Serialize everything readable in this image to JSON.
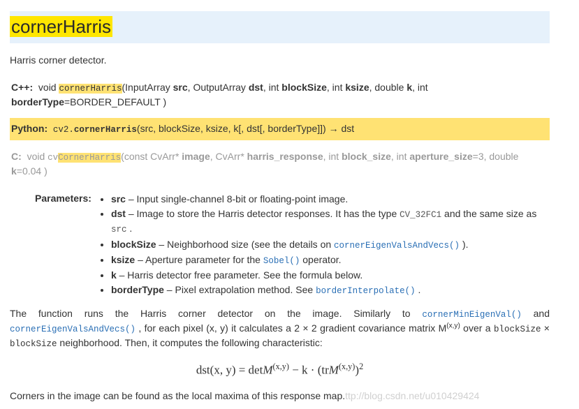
{
  "title": "cornerHarris",
  "brief": "Harris corner detector.",
  "sig_cpp": {
    "lang": "C++:",
    "pre": "void ",
    "fn": "cornerHarris",
    "line1_a": "(InputArray ",
    "p1": "src",
    "line1_b": ", OutputArray ",
    "p2": "dst",
    "line1_c": ", int ",
    "p3": "blockSize",
    "line1_d": ", int ",
    "p4": "ksize",
    "line1_e": ", double ",
    "p5": "k",
    "line1_f": ", int",
    "line2_a": "borderType",
    "line2_b": "=BORDER_DEFAULT )"
  },
  "sig_py": {
    "lang": "Python:",
    "mod": "cv2.",
    "fn": "cornerHarris",
    "args": "(src, blockSize, ksize, k[, dst[, borderType]]) → dst"
  },
  "sig_c": {
    "lang": "C:",
    "pre": "void ",
    "fn_pre": "cv",
    "fn": "CornerHarris",
    "a": "(const CvArr* ",
    "p1": "image",
    "b": ", CvArr* ",
    "p2": "harris_response",
    "c": ", int ",
    "p3": "block_size",
    "d": ", int ",
    "p4": "aperture_size",
    "e": "=3, double ",
    "p5": "k",
    "f": "=0.04 )"
  },
  "params_label": "Parameters:",
  "params": {
    "src": {
      "name": "src",
      "text": " – Input single-channel 8-bit or floating-point image."
    },
    "dst": {
      "name": "dst",
      "t1": " – Image to store the Harris detector responses. It has the type ",
      "code": "CV_32FC1",
      "t2": " and the same size as ",
      "code2": "src",
      "t3": " ."
    },
    "blockSize": {
      "name": "blockSize",
      "t1": " – Neighborhood size (see the details on ",
      "link": "cornerEigenValsAndVecs()",
      "t2": " )."
    },
    "ksize": {
      "name": "ksize",
      "t1": " – Aperture parameter for the ",
      "link": "Sobel()",
      "t2": " operator."
    },
    "k": {
      "name": "k",
      "text": " – Harris detector free parameter. See the formula below."
    },
    "borderType": {
      "name": "borderType",
      "t1": " – Pixel extrapolation method. See ",
      "link": "borderInterpolate()",
      "t2": " ."
    }
  },
  "desc1": {
    "a": "The function runs the Harris corner detector on the image. Similarly to ",
    "l1": "cornerMinEigenVal()",
    "b": " and ",
    "l2": "cornerEigenValsAndVecs()",
    "c": " , for each pixel (x, y) it calculates a 2 × 2 gradient covariance matrix M",
    "sup": "(x,y)",
    "d": " over a ",
    "m1": "blockSize",
    "e": " × ",
    "m2": "blockSize",
    "f": " neighborhood. Then, it computes the following characteristic:"
  },
  "formula": {
    "lhs": "dst(x, y) = det",
    "M1": "M",
    "sup1": "(x,y)",
    "mid": " − k · (tr",
    "M2": "M",
    "sup2": "(x,y)",
    "end": ")",
    "sq": "2"
  },
  "desc2": "Corners in the image can be found as the local maxima of this response map.",
  "watermark": "ttp://blog.csdn.net/u010429424"
}
